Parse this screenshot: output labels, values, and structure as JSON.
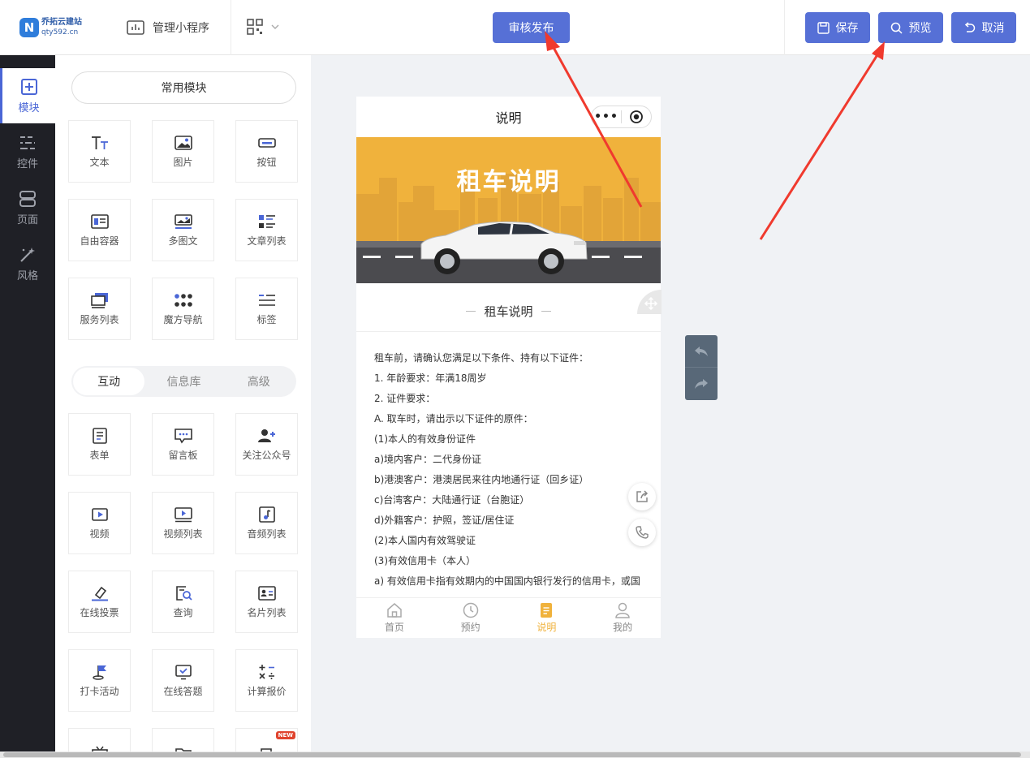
{
  "header": {
    "logo": {
      "name": "乔拓云建站",
      "domain": "qty592.cn",
      "badge": "N"
    },
    "manage_label": "管理小程序",
    "publish_label": "审核发布",
    "save_label": "保存",
    "preview_label": "预览",
    "cancel_label": "取消"
  },
  "rail": {
    "items": [
      {
        "label": "模块",
        "icon": "plus-square-icon",
        "active": true
      },
      {
        "label": "控件",
        "icon": "sliders-icon"
      },
      {
        "label": "页面",
        "icon": "pages-icon"
      },
      {
        "label": "风格",
        "icon": "magic-wand-icon"
      }
    ]
  },
  "panel": {
    "common_label": "常用模块",
    "common": [
      {
        "label": "文本",
        "icon": "text-icon"
      },
      {
        "label": "图片",
        "icon": "image-icon"
      },
      {
        "label": "按钮",
        "icon": "button-icon"
      },
      {
        "label": "自由容器",
        "icon": "container-icon"
      },
      {
        "label": "多图文",
        "icon": "multi-image-icon"
      },
      {
        "label": "文章列表",
        "icon": "article-list-icon"
      },
      {
        "label": "服务列表",
        "icon": "service-list-icon"
      },
      {
        "label": "魔方导航",
        "icon": "grid-nav-icon"
      },
      {
        "label": "标签",
        "icon": "tag-icon"
      }
    ],
    "tabs": [
      "互动",
      "信息库",
      "高级"
    ],
    "interactive": [
      {
        "label": "表单",
        "icon": "form-icon"
      },
      {
        "label": "留言板",
        "icon": "message-board-icon"
      },
      {
        "label": "关注公众号",
        "icon": "follow-icon"
      },
      {
        "label": "视频",
        "icon": "video-icon"
      },
      {
        "label": "视频列表",
        "icon": "video-list-icon"
      },
      {
        "label": "音频列表",
        "icon": "audio-list-icon"
      },
      {
        "label": "在线投票",
        "icon": "vote-icon"
      },
      {
        "label": "查询",
        "icon": "query-icon"
      },
      {
        "label": "名片列表",
        "icon": "card-list-icon"
      },
      {
        "label": "打卡活动",
        "icon": "checkin-flag-icon"
      },
      {
        "label": "在线答题",
        "icon": "quiz-icon"
      },
      {
        "label": "计算报价",
        "icon": "calculator-icon"
      }
    ],
    "new_badge": "NEW"
  },
  "phone": {
    "title": "说明",
    "banner_title": "租车说明",
    "section_title": "租车说明",
    "lines": [
      "租车前，请确认您满足以下条件、持有以下证件：",
      "1. 年龄要求：年满18周岁",
      "2. 证件要求：",
      "A. 取车时，请出示以下证件的原件：",
      "(1)本人的有效身份证件",
      "a)境内客户：二代身份证",
      "b)港澳客户：港澳居民来往内地通行证（回乡证）",
      "c)台湾客户：大陆通行证（台胞证）",
      "d)外籍客户：护照，签证/居住证",
      "(2)本人国内有效驾驶证",
      "(3)有效信用卡（本人）",
      "a) 有效信用卡指有效期内的中国国内银行发行的信用卡，或国"
    ],
    "tabs": [
      {
        "label": "首页",
        "icon": "home-icon"
      },
      {
        "label": "预约",
        "icon": "clock-icon"
      },
      {
        "label": "说明",
        "icon": "document-icon",
        "active": true
      },
      {
        "label": "我的",
        "icon": "user-icon"
      }
    ]
  },
  "colors": {
    "primary": "#5670d6",
    "accent": "#f0b23c",
    "rail": "#1f2026",
    "annotation": "#f03a2e"
  }
}
